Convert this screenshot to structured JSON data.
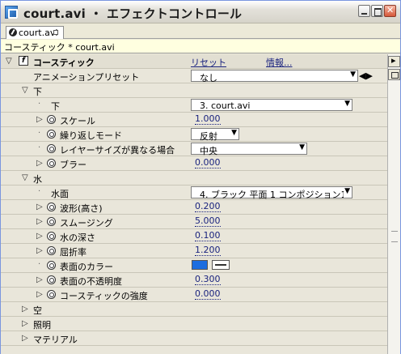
{
  "window": {
    "title": "court.avi ・ エフェクトコントロール"
  },
  "tab": {
    "label": "court.avi"
  },
  "header": {
    "path": "コースティック * court.avi"
  },
  "effect": {
    "fx_glyph": "f",
    "name": "コースティック",
    "reset_label": "リセット",
    "about_label": "情報..."
  },
  "preset": {
    "label": "アニメーションプリセット",
    "value": "なし"
  },
  "groups": {
    "bottom": {
      "label": "下",
      "source_label": "下",
      "source_value": "3. court.avi",
      "scale_label": "スケール",
      "scale_value": "1.000",
      "repeat_label": "繰り返しモード",
      "repeat_value": "反射",
      "layer_size_label": "レイヤーサイズが異なる場合",
      "layer_size_value": "中央",
      "blur_label": "ブラー",
      "blur_value": "0.000"
    },
    "water": {
      "label": "水",
      "surface_label": "水面",
      "surface_value": "4. ブラック 平面 1 コンポジション1",
      "wave_label": "波形(高さ)",
      "wave_value": "0.200",
      "smooth_label": "スムージング",
      "smooth_value": "5.000",
      "depth_label": "水の深さ",
      "depth_value": "0.100",
      "refract_label": "屈折率",
      "refract_value": "1.200",
      "color_label": "表面のカラー",
      "color_hex": "#1C6DDF",
      "opacity_label": "表面の不透明度",
      "opacity_value": "0.300",
      "caustics_label": "コースティックの強度",
      "caustics_value": "0.000"
    },
    "sky": {
      "label": "空"
    },
    "lighting": {
      "label": "照明"
    },
    "material": {
      "label": "マテリアル"
    }
  }
}
